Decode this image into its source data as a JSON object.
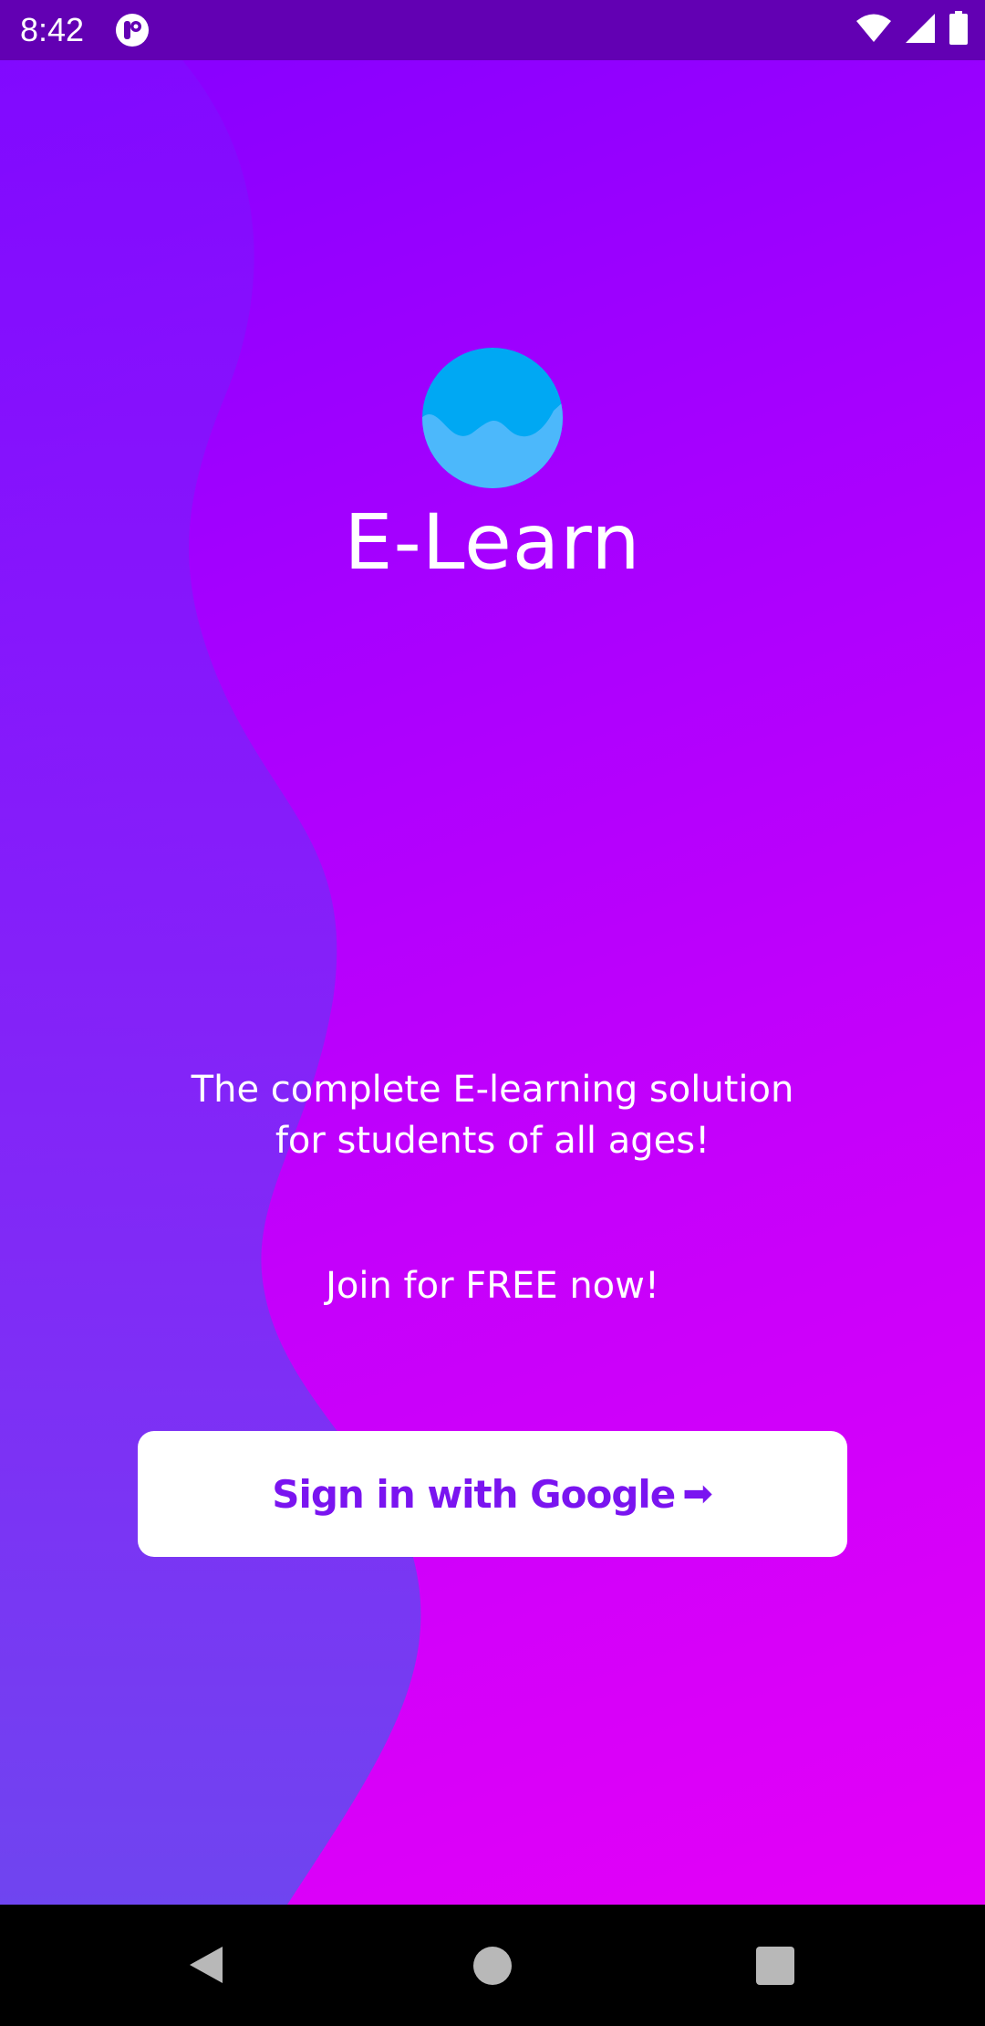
{
  "status_bar": {
    "time": "8:42",
    "app_icon": "notification-app-icon",
    "wifi_icon": "wifi-icon",
    "signal_icon": "cell-signal-icon",
    "battery_icon": "battery-icon",
    "background_color": "#6200b3"
  },
  "app": {
    "logo_icon": "wave-logo-icon",
    "name": "E-Learn"
  },
  "tagline": {
    "line1": "The complete E-learning solution",
    "line2": "for students of all ages!"
  },
  "cta": {
    "text": "Join for FREE now!"
  },
  "sign_in_button": {
    "label": "Sign in with Google",
    "arrow": "➡",
    "text_color": "#7a14f0",
    "background_color": "#ffffff"
  },
  "nav_bar": {
    "back_icon": "back-icon",
    "home_icon": "home-icon",
    "recents_icon": "recents-icon"
  },
  "colors": {
    "gradient_start": "#8600ff",
    "gradient_end": "#e400f8",
    "wave_color": "#6f45f0",
    "logo_blue": "#00a8f3"
  }
}
